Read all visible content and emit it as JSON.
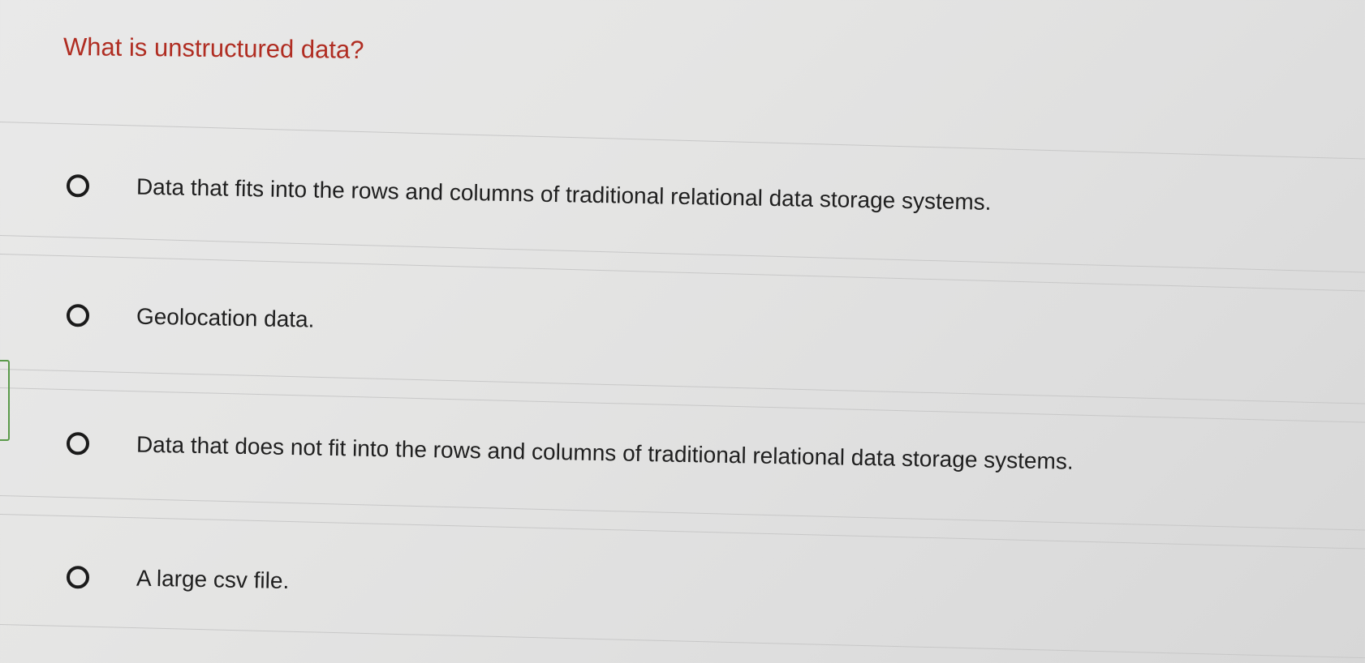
{
  "question": {
    "title": "What is unstructured data?"
  },
  "options": [
    {
      "label": "Data that fits into the rows and columns of traditional relational data storage systems.",
      "selected": false
    },
    {
      "label": "Geolocation data.",
      "selected": false
    },
    {
      "label": "Data that does not fit into the rows and columns of traditional relational data storage systems.",
      "selected": false
    },
    {
      "label": "A large csv file.",
      "selected": false
    }
  ],
  "colors": {
    "question_text": "#b02d22",
    "option_text": "#1f1f1f",
    "radio_border": "#1a1a1a",
    "divider": "#c8c8c8",
    "edge_marker": "#5a9a4a"
  }
}
